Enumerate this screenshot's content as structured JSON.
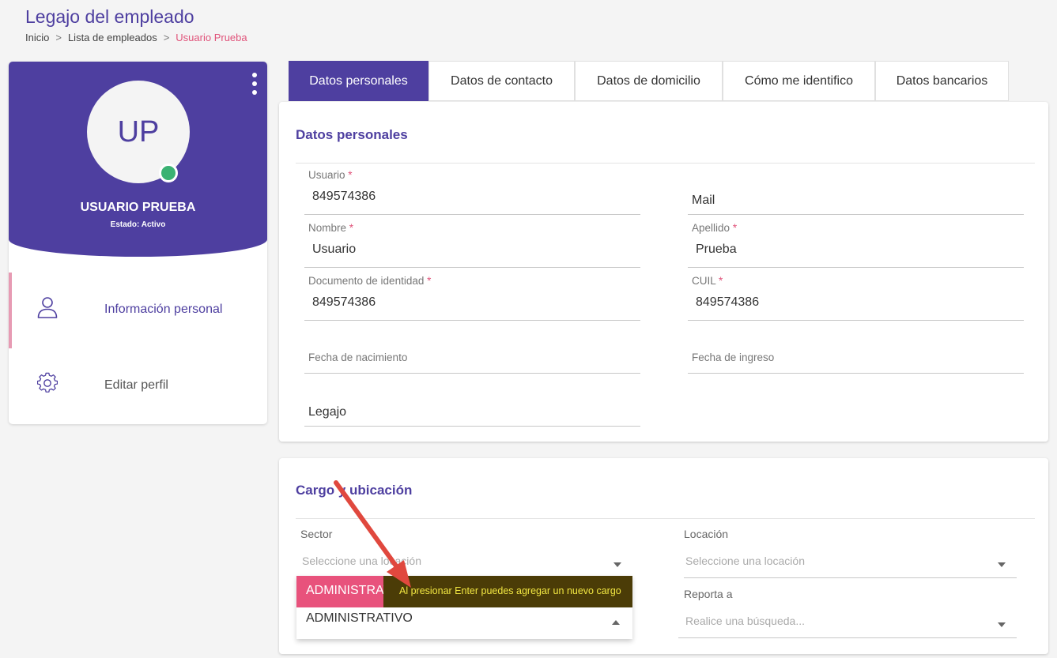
{
  "page": {
    "title": "Legajo del empleado",
    "breadcrumb": [
      {
        "label": "Inicio"
      },
      {
        "label": "Lista de empleados"
      },
      {
        "label": "Usuario Prueba"
      }
    ],
    "breadcrumb_separator": ">"
  },
  "profile": {
    "initials": "UP",
    "name": "USUARIO PRUEBA",
    "status": "Estado: Activo",
    "menu": [
      {
        "label": "Información personal",
        "icon": "user-icon",
        "active": true
      },
      {
        "label": "Editar perfil",
        "icon": "gear-icon",
        "active": false
      }
    ]
  },
  "tabs": [
    {
      "label": "Datos personales",
      "active": true
    },
    {
      "label": "Datos de contacto"
    },
    {
      "label": "Datos de domicilio"
    },
    {
      "label": "Cómo me identifico"
    },
    {
      "label": "Datos bancarios"
    }
  ],
  "datos_personales": {
    "title": "Datos personales",
    "fields": {
      "usuario": {
        "label": "Usuario",
        "required": "*",
        "value": "849574386"
      },
      "mail": {
        "label": "Mail",
        "value": ""
      },
      "nombre": {
        "label": "Nombre",
        "required": "*",
        "value": "Usuario"
      },
      "apellido": {
        "label": "Apellido",
        "required": "*",
        "value": "Prueba"
      },
      "documento": {
        "label": "Documento de identidad",
        "required": "*",
        "value": "849574386"
      },
      "cuil": {
        "label": "CUIL",
        "required": "*",
        "value": "849574386"
      },
      "fecha_nacimiento": {
        "label": "Fecha de nacimiento",
        "value": ""
      },
      "fecha_ingreso": {
        "label": "Fecha de ingreso",
        "value": ""
      },
      "legajo": {
        "label": "Legajo",
        "value": ""
      }
    }
  },
  "cargo": {
    "title": "Cargo y ubicación",
    "sector": {
      "label": "Sector",
      "placeholder": "Seleccione una locación"
    },
    "locacion": {
      "label": "Locación",
      "placeholder": "Seleccione una locación"
    },
    "reporta": {
      "label": "Reporta a",
      "placeholder": "Realice una búsqueda..."
    },
    "dropdown": {
      "option": "ADMINISTRATIVO",
      "tooltip": "Al presionar Enter puedes agregar un nuevo cargo",
      "input_value": "ADMINISTRATIVO"
    }
  },
  "colors": {
    "primary": "#4e3fa0",
    "accent": "#e0537a",
    "online": "#3bb273",
    "tooltip_bg": "#4b3c07",
    "tooltip_text": "#f2e742",
    "annotation_arrow": "#e0483e"
  }
}
